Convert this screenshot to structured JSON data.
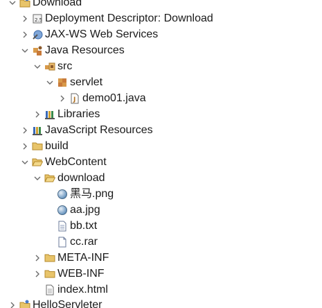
{
  "tree": {
    "project": {
      "label": "Download"
    },
    "deployment_descriptor": {
      "label": "Deployment Descriptor: Download"
    },
    "jaxws": {
      "label": "JAX-WS Web Services"
    },
    "java_resources": {
      "label": "Java Resources"
    },
    "src": {
      "label": "src"
    },
    "servlet": {
      "label": "servlet"
    },
    "demo01": {
      "label": "demo01.java"
    },
    "libraries": {
      "label": "Libraries"
    },
    "js_resources": {
      "label": "JavaScript Resources"
    },
    "build": {
      "label": "build"
    },
    "webcontent": {
      "label": "WebContent"
    },
    "download_folder": {
      "label": "download"
    },
    "heima_png": {
      "label": "黑马.png"
    },
    "aa_jpg": {
      "label": "aa.jpg"
    },
    "bb_txt": {
      "label": "bb.txt"
    },
    "cc_rar": {
      "label": "cc.rar"
    },
    "meta_inf": {
      "label": "META-INF"
    },
    "web_inf": {
      "label": "WEB-INF"
    },
    "index_html": {
      "label": "index.html"
    },
    "hello_servleter": {
      "label": "HelloServleter"
    }
  },
  "colors": {
    "chevron": "#6b6b6b",
    "folder": "#e8c46a",
    "folder_stroke": "#b48a2c"
  }
}
